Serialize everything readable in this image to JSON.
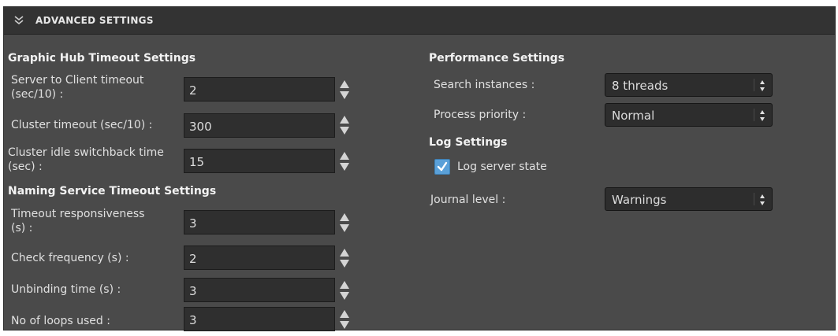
{
  "header": {
    "title": "ADVANCED SETTINGS",
    "icon": "double-chevron-down-icon"
  },
  "graphic_hub": {
    "title": "Graphic Hub Timeout Settings",
    "fields": [
      {
        "label_line1": "Server to Client timeout",
        "label_line2": "(sec/10) :",
        "value": "2"
      },
      {
        "label_line1": "Cluster timeout (sec/10) :",
        "label_line2": "",
        "value": "300"
      },
      {
        "label_line1": "Cluster idle switchback time",
        "label_line2": "(sec) :",
        "value": "15"
      }
    ]
  },
  "naming_service": {
    "title": "Naming Service Timeout Settings",
    "fields": [
      {
        "label_line1": "Timeout responsiveness",
        "label_line2": "(s) :",
        "value": "3"
      },
      {
        "label_line1": "Check frequency (s) :",
        "label_line2": "",
        "value": "2"
      },
      {
        "label_line1": "Unbinding time (s) :",
        "label_line2": "",
        "value": "3"
      },
      {
        "label_line1": "No of loops used :",
        "label_line2": "",
        "value": "3"
      }
    ]
  },
  "performance": {
    "title": "Performance Settings",
    "search_instances": {
      "label": "Search instances :",
      "value": "8 threads"
    },
    "process_priority": {
      "label": "Process priority :",
      "value": "Normal"
    }
  },
  "log": {
    "title": "Log Settings",
    "log_server_state": {
      "label": "Log server state",
      "checked": true
    },
    "journal_level": {
      "label": "Journal level :",
      "value": "Warnings"
    }
  },
  "colors": {
    "panel": "#4a4a4a",
    "header": "#333333",
    "input": "#2f2f2f",
    "checkbox": "#5aa0d8"
  }
}
